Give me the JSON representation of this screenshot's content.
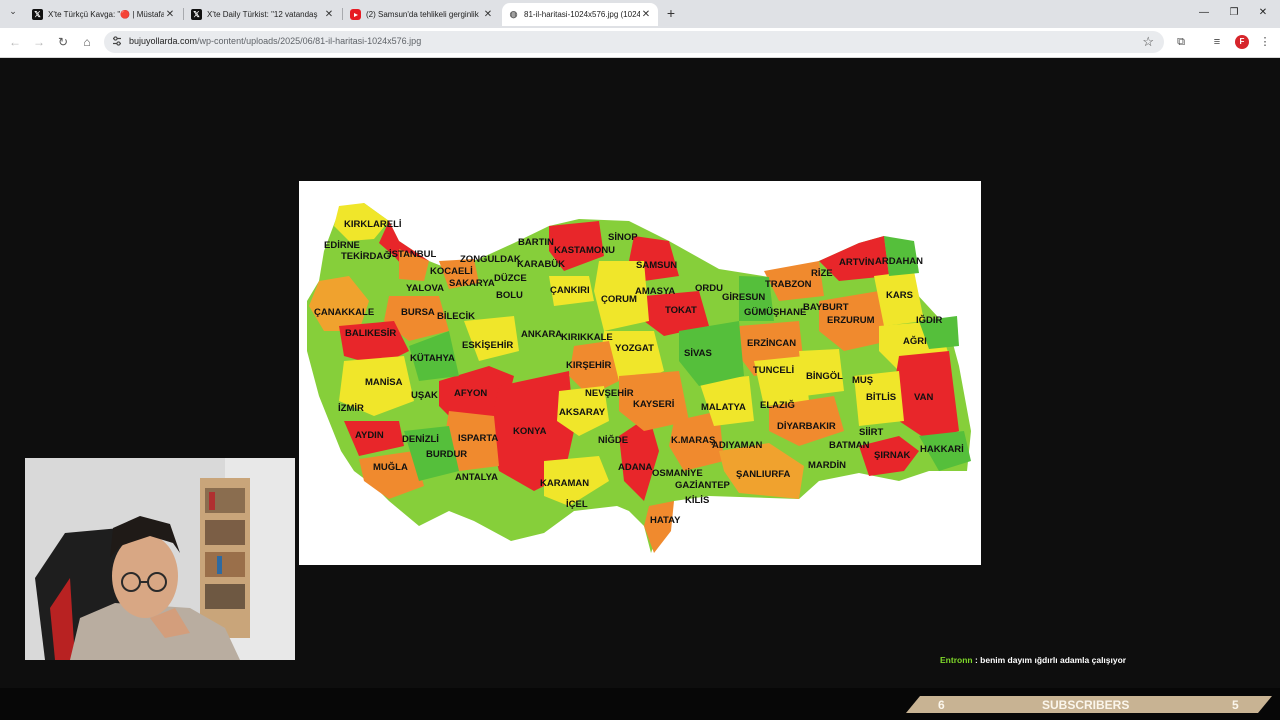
{
  "browser": {
    "tabs": [
      {
        "title": "X'te Türkçü Kavga: \"🔴 | Müstafa",
        "icon": "x-logo-icon",
        "active": false
      },
      {
        "title": "X'te Daily Türkist: \"12 vatandaş",
        "icon": "x-logo-icon",
        "active": false
      },
      {
        "title": "(2) Samsun'da tehlikeli gerginlik",
        "icon": "youtube-icon",
        "active": false
      },
      {
        "title": "81-il-haritasi-1024x576.jpg (1024",
        "icon": "globe-icon",
        "active": true
      }
    ],
    "close_glyph": "✕",
    "new_tab_glyph": "+",
    "tab_list_glyph": "⌄",
    "window_controls": {
      "minimize": "—",
      "restore": "❐",
      "close": "✕"
    },
    "address": {
      "host": "bujuyollarda.com",
      "path": "/wp-content/uploads/2025/06/81-il-haritasi-1024x576.jpg"
    },
    "nav_glyphs": {
      "back": "←",
      "forward": "→",
      "reload": "↻",
      "home": "⌂"
    },
    "toolbar_glyphs": {
      "star": "☆",
      "extensions": "⧉",
      "media": "≡",
      "menu": "⋮",
      "profile": "F"
    }
  },
  "map": {
    "provinces": [
      {
        "name": "KIRKLARELİ"
      },
      {
        "name": "EDİRNE"
      },
      {
        "name": "TEKİRDAĞ"
      },
      {
        "name": "İSTANBUL"
      },
      {
        "name": "KOCAELİ"
      },
      {
        "name": "ZONGULDAK"
      },
      {
        "name": "BARTIN"
      },
      {
        "name": "KASTAMONU"
      },
      {
        "name": "SİNOP"
      },
      {
        "name": "SAMSUN"
      },
      {
        "name": "KARABÜK"
      },
      {
        "name": "DÜZCE"
      },
      {
        "name": "YALOVA"
      },
      {
        "name": "SAKARYA"
      },
      {
        "name": "BOLU"
      },
      {
        "name": "ÇANKIRI"
      },
      {
        "name": "ÇORUM"
      },
      {
        "name": "AMASYA"
      },
      {
        "name": "ORDU"
      },
      {
        "name": "GİRESUN"
      },
      {
        "name": "TRABZON"
      },
      {
        "name": "RİZE"
      },
      {
        "name": "ARTVİN"
      },
      {
        "name": "ARDAHAN"
      },
      {
        "name": "KARS"
      },
      {
        "name": "IĞDIR"
      },
      {
        "name": "AĞRI"
      },
      {
        "name": "ÇANAKKALE"
      },
      {
        "name": "BURSA"
      },
      {
        "name": "BİLECİK"
      },
      {
        "name": "TOKAT"
      },
      {
        "name": "GÜMÜŞHANE"
      },
      {
        "name": "BAYBURT"
      },
      {
        "name": "ERZURUM"
      },
      {
        "name": "BALIKESİR"
      },
      {
        "name": "ESKİŞEHİR"
      },
      {
        "name": "ANKARA"
      },
      {
        "name": "KIRIKKALE"
      },
      {
        "name": "YOZGAT"
      },
      {
        "name": "SİVAS"
      },
      {
        "name": "ERZİNCAN"
      },
      {
        "name": "KÜTAHYA"
      },
      {
        "name": "KIRŞEHİR"
      },
      {
        "name": "TUNCELİ"
      },
      {
        "name": "BİNGÖL"
      },
      {
        "name": "MUŞ"
      },
      {
        "name": "MANİSA"
      },
      {
        "name": "AFYON"
      },
      {
        "name": "NEVŞEHİR"
      },
      {
        "name": "UŞAK"
      },
      {
        "name": "KAYSERİ"
      },
      {
        "name": "MALATYA"
      },
      {
        "name": "ELAZIĞ"
      },
      {
        "name": "BİTLİS"
      },
      {
        "name": "VAN"
      },
      {
        "name": "İZMİR"
      },
      {
        "name": "AKSARAY"
      },
      {
        "name": "KONYA"
      },
      {
        "name": "DİYARBAKIR"
      },
      {
        "name": "AYDIN"
      },
      {
        "name": "DENİZLİ"
      },
      {
        "name": "ISPARTA"
      },
      {
        "name": "NİĞDE"
      },
      {
        "name": "K.MARAŞ"
      },
      {
        "name": "SİİRT"
      },
      {
        "name": "BURDUR"
      },
      {
        "name": "ADIYAMAN"
      },
      {
        "name": "BATMAN"
      },
      {
        "name": "HAKKARİ"
      },
      {
        "name": "ŞIRNAK"
      },
      {
        "name": "MUĞLA"
      },
      {
        "name": "ADANA"
      },
      {
        "name": "MARDİN"
      },
      {
        "name": "OSMANİYE"
      },
      {
        "name": "ŞANLIURFA"
      },
      {
        "name": "ANTALYA"
      },
      {
        "name": "KARAMAN"
      },
      {
        "name": "GAZİANTEP"
      },
      {
        "name": "KİLİS"
      },
      {
        "name": "İÇEL"
      },
      {
        "name": "HATAY"
      }
    ],
    "legend_colors": {
      "red": "#e8262a",
      "orange": "#f08a2e",
      "yellow": "#f0e62a",
      "light_green": "#9fd83a",
      "green": "#55bf3b"
    }
  },
  "chat": {
    "user": "Entronn",
    "message": ": benim dayım ığdırlı adamla çalışıyor"
  },
  "subscribers": {
    "left_count": "6",
    "label": "SUBSCRIBERS",
    "right_count": "5"
  }
}
